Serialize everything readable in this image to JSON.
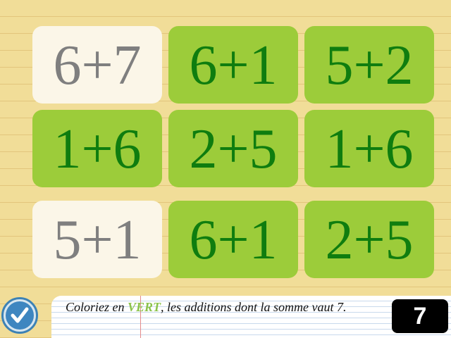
{
  "tiles": [
    {
      "label": "6+7",
      "state": "white"
    },
    {
      "label": "6+1",
      "state": "green"
    },
    {
      "label": "5+2",
      "state": "green"
    },
    {
      "label": "1+6",
      "state": "green"
    },
    {
      "label": "2+5",
      "state": "green"
    },
    {
      "label": "1+6",
      "state": "green"
    },
    {
      "label": "5+1",
      "state": "white"
    },
    {
      "label": "6+1",
      "state": "green"
    },
    {
      "label": "2+5",
      "state": "green"
    }
  ],
  "instruction": {
    "prefix": "Coloriez en ",
    "highlight": "VERT",
    "suffix": ", les additions dont la somme vaut 7."
  },
  "target_sum": "7",
  "colors": {
    "green_tile": "#9ccc3a",
    "green_text": "#0f7d0f",
    "white_tile": "#fbf6e8",
    "gray_text": "#7f7f7f",
    "highlight": "#8bc34a"
  },
  "icons": {
    "validate": "checkmark-icon"
  }
}
